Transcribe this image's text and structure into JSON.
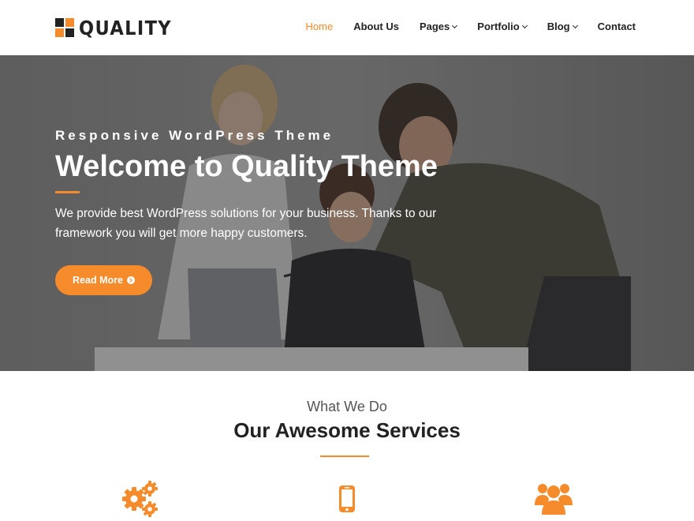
{
  "brand": {
    "name": "QUALITY",
    "icon": "logo-squares-icon",
    "accent": "#f58b2a"
  },
  "nav": {
    "items": [
      {
        "label": "Home",
        "active": true
      },
      {
        "label": "About Us"
      },
      {
        "label": "Pages",
        "dropdown": true
      },
      {
        "label": "Portfolio",
        "dropdown": true
      },
      {
        "label": "Blog",
        "dropdown": true
      },
      {
        "label": "Contact"
      }
    ]
  },
  "hero": {
    "tagline": "Responsive WordPress Theme",
    "title": "Welcome to Quality Theme",
    "description": "We provide best WordPress solutions for your business. Thanks to our framework you will get more happy customers.",
    "button_label": "Read More"
  },
  "services": {
    "subtitle": "What We Do",
    "title_prefix": "Our ",
    "title_bold": "Awesome",
    "title_suffix": " Services",
    "icons": [
      "gears-icon",
      "mobile-phone-icon",
      "users-icon"
    ]
  }
}
